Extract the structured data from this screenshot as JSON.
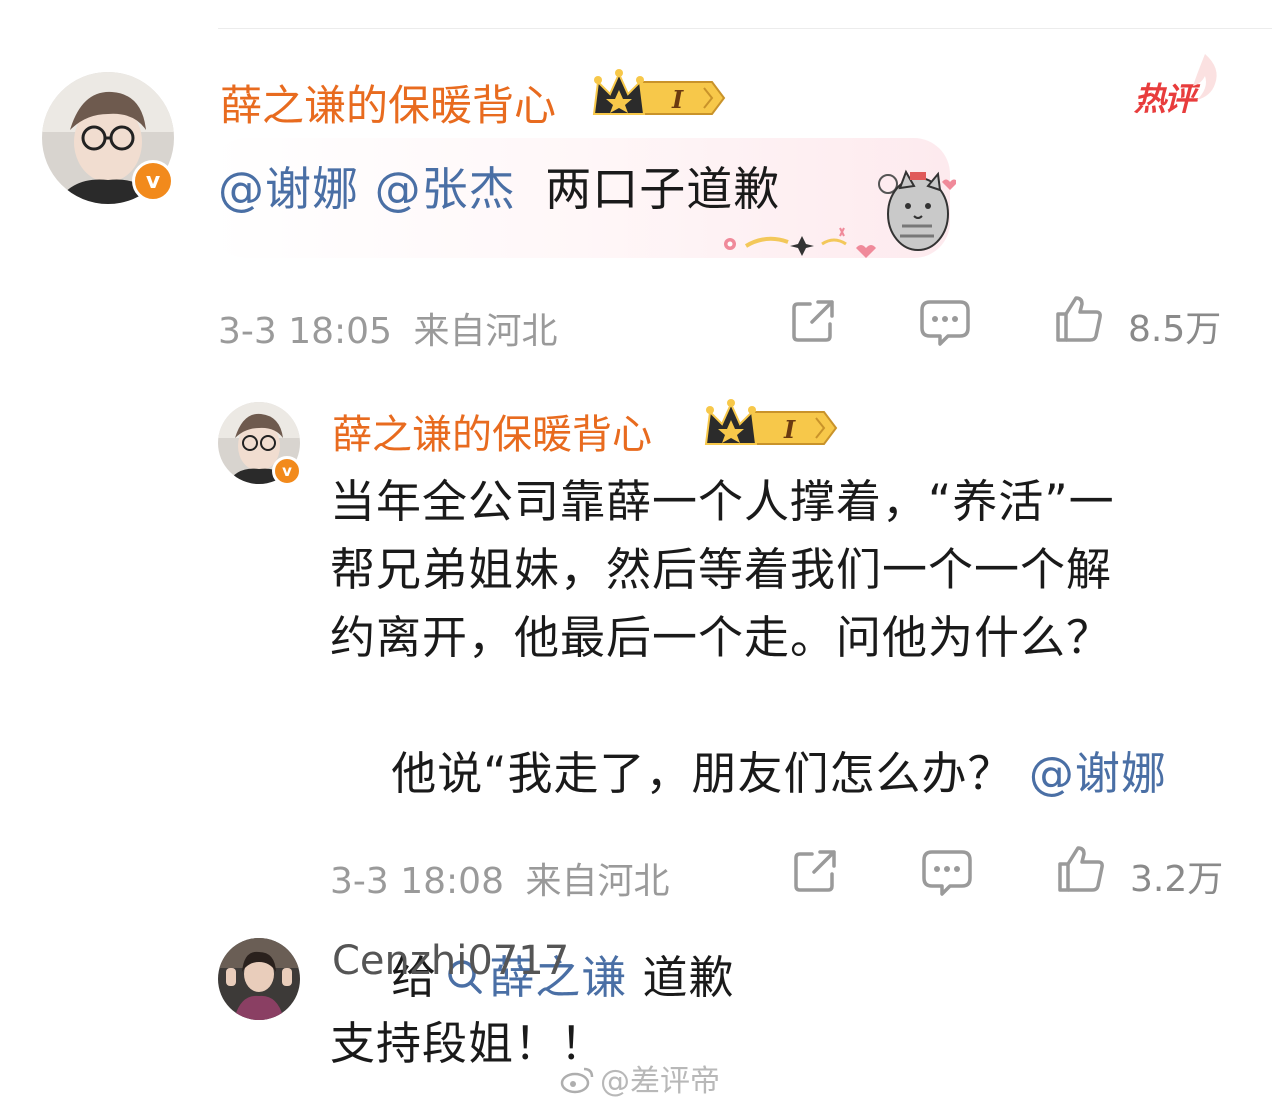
{
  "hot_label": "热评",
  "main_comment": {
    "username": "薛之谦的保暖背心",
    "level_badge": "I",
    "mentions": [
      "@谢娜",
      "@张杰"
    ],
    "text": "两口子道歉",
    "timestamp": "3-3 18:05",
    "location": "来自河北",
    "likes": "8.5万"
  },
  "reply": {
    "username": "薛之谦的保暖背心",
    "level_badge": "I",
    "text_lines": [
      "当年全公司靠薛一个人撑着，“养活”一",
      "帮兄弟姐妹，然后等着我们一个一个解",
      "约离开，他最后一个走。问他为什么？"
    ],
    "line4_text": "他说“我走了，朋友们怎么办？ ",
    "line4_mention": "@谢娜",
    "line5_prefix": "给",
    "line5_topic": "薛之谦",
    "line5_suffix": " 道歉",
    "timestamp": "3-3 18:08",
    "location": "来自河北",
    "likes": "3.2万"
  },
  "third_comment": {
    "username": "Cenzhi0717",
    "text": "支持段姐！！"
  },
  "watermark": "@差评帝",
  "icons": {
    "share": "share-icon",
    "comment": "comment-icon",
    "like": "thumb-up-icon",
    "search": "search-icon"
  },
  "colors": {
    "username": "#e86b1f",
    "mention": "#4a6fa5",
    "meta": "#9a9a9a",
    "hot": "#e83c3c",
    "verified": "#f28a1c"
  }
}
